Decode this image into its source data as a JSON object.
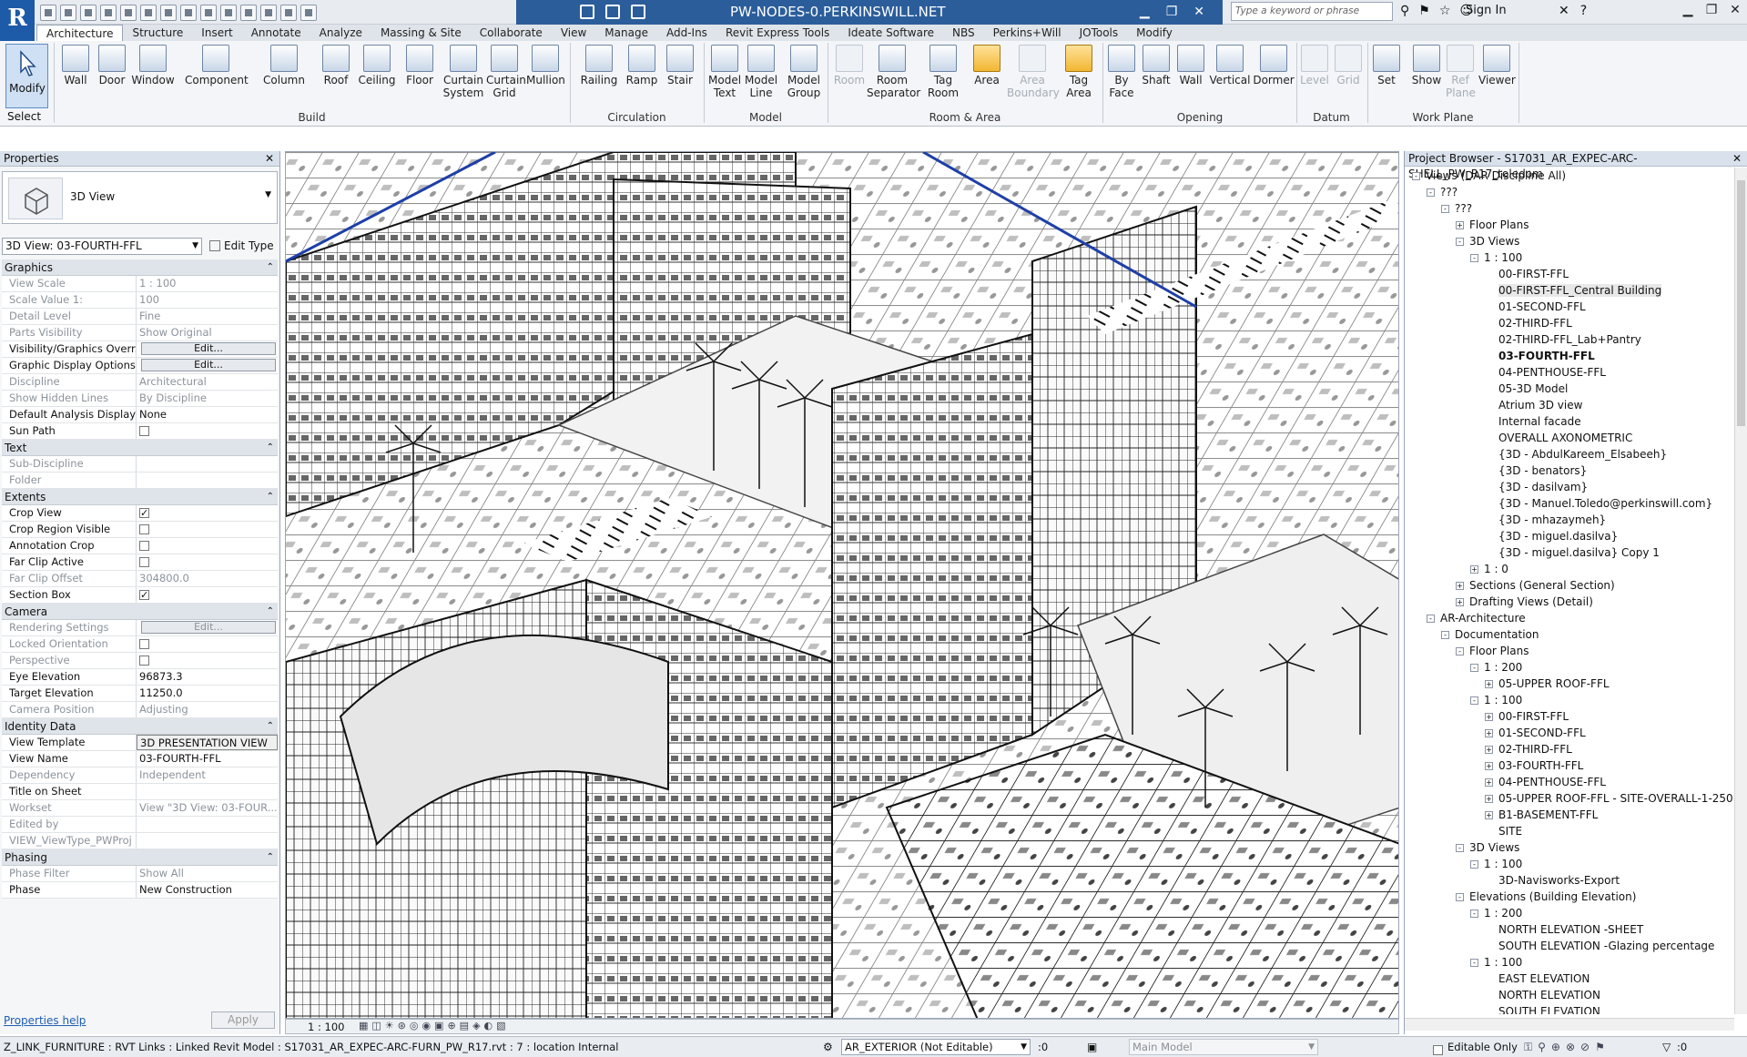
{
  "titlebar": {
    "server_title": "PW-NODES-0.PERKINSWILL.NET",
    "search_placeholder": "Type a keyword or phrase",
    "sign_in": "Sign In"
  },
  "ribbon_tabs": [
    "Architecture",
    "Structure",
    "Insert",
    "Annotate",
    "Analyze",
    "Massing & Site",
    "Collaborate",
    "View",
    "Manage",
    "Add-Ins",
    "Revit Express Tools",
    "Ideate Software",
    "NBS",
    "Perkins+Will",
    "JOTools",
    "Modify"
  ],
  "ribbon": {
    "select_label": "Select",
    "modify": "Modify",
    "build": [
      "Wall",
      "Door",
      "Window",
      "Component",
      "Column",
      "Roof",
      "Ceiling",
      "Floor",
      "Curtain System",
      "Curtain Grid",
      "Mullion"
    ],
    "circulation": [
      "Railing",
      "Ramp",
      "Stair"
    ],
    "model": [
      "Model Text",
      "Model Line",
      "Model Group"
    ],
    "room_area": [
      "Room",
      "Room Separator",
      "Tag Room",
      "Area",
      "Area Boundary",
      "Tag Area"
    ],
    "opening": [
      "By Face",
      "Shaft",
      "Wall",
      "Vertical",
      "Dormer"
    ],
    "datum": [
      "Level",
      "Grid"
    ],
    "workplane": [
      "Set",
      "Show",
      "Ref Plane",
      "Viewer"
    ],
    "panels": [
      "Build",
      "Circulation",
      "Model",
      "Room & Area",
      "Opening",
      "Datum",
      "Work Plane"
    ]
  },
  "properties": {
    "title": "Properties",
    "type_name": "3D View",
    "view_selector": "3D View: 03-FOURTH-FFL",
    "edit_type": "Edit Type",
    "help": "Properties help",
    "apply": "Apply",
    "groups": [
      {
        "name": "Graphics",
        "rows": [
          [
            "View Scale",
            "1 : 100",
            true
          ],
          [
            "Scale Value    1:",
            "100",
            true
          ],
          [
            "Detail Level",
            "Fine",
            true
          ],
          [
            "Parts Visibility",
            "Show Original",
            true
          ],
          [
            "Visibility/Graphics Overr...",
            "Edit...",
            false
          ],
          [
            "Graphic Display Options",
            "Edit...",
            false
          ],
          [
            "Discipline",
            "Architectural",
            true
          ],
          [
            "Show Hidden Lines",
            "By Discipline",
            true
          ],
          [
            "Default Analysis Display ...",
            "None",
            false
          ],
          [
            "Sun Path",
            "",
            false
          ]
        ]
      },
      {
        "name": "Text",
        "rows": [
          [
            "Sub-Discipline",
            "",
            true
          ],
          [
            "Folder",
            "",
            true
          ]
        ]
      },
      {
        "name": "Extents",
        "rows": [
          [
            "Crop View",
            "",
            false
          ],
          [
            "Crop Region Visible",
            "",
            false
          ],
          [
            "Annotation Crop",
            "",
            false
          ],
          [
            "Far Clip Active",
            "",
            false
          ],
          [
            "Far Clip Offset",
            "304800.0",
            true
          ],
          [
            "Section Box",
            "",
            false
          ]
        ]
      },
      {
        "name": "Camera",
        "rows": [
          [
            "Rendering Settings",
            "Edit...",
            true
          ],
          [
            "Locked Orientation",
            "",
            true
          ],
          [
            "Perspective",
            "",
            true
          ],
          [
            "Eye Elevation",
            "96873.3",
            false
          ],
          [
            "Target Elevation",
            "11250.0",
            false
          ],
          [
            "Camera Position",
            "Adjusting",
            true
          ]
        ]
      },
      {
        "name": "Identity Data",
        "rows": [
          [
            "View Template",
            "3D PRESENTATION VIEW",
            false
          ],
          [
            "View Name",
            "03-FOURTH-FFL",
            false
          ],
          [
            "Dependency",
            "Independent",
            true
          ],
          [
            "Title on Sheet",
            "",
            false
          ],
          [
            "Workset",
            "View \"3D View: 03-FOUR...",
            true
          ],
          [
            "Edited by",
            "",
            true
          ],
          [
            "VIEW_ViewType_PWProj",
            "",
            true
          ]
        ]
      },
      {
        "name": "Phasing",
        "rows": [
          [
            "Phase Filter",
            "Show All",
            true
          ],
          [
            "Phase",
            "New Construction",
            false
          ]
        ]
      }
    ]
  },
  "viewport": {
    "scale": "1 : 100"
  },
  "browser": {
    "title": "Project Browser - S17031_AR_EXPEC-ARC-SHELL_PW_R17_toledom",
    "nodes": [
      [
        0,
        "-",
        "Views (DAR Discipline All)"
      ],
      [
        1,
        "-",
        "???"
      ],
      [
        2,
        "-",
        "???"
      ],
      [
        3,
        "+",
        "Floor Plans"
      ],
      [
        3,
        "-",
        "3D Views"
      ],
      [
        4,
        "-",
        "1 : 100"
      ],
      [
        5,
        "",
        "00-FIRST-FFL"
      ],
      [
        5,
        "",
        "00-FIRST-FFL_Central Building"
      ],
      [
        5,
        "",
        "01-SECOND-FFL"
      ],
      [
        5,
        "",
        "02-THIRD-FFL"
      ],
      [
        5,
        "",
        "02-THIRD-FFL_Lab+Pantry"
      ],
      [
        5,
        "",
        "03-FOURTH-FFL"
      ],
      [
        5,
        "",
        "04-PENTHOUSE-FFL"
      ],
      [
        5,
        "",
        "05-3D Model"
      ],
      [
        5,
        "",
        "Atrium 3D view"
      ],
      [
        5,
        "",
        "Internal facade"
      ],
      [
        5,
        "",
        "OVERALL AXONOMETRIC"
      ],
      [
        5,
        "",
        "{3D - AbdulKareem_Elsabeeh}"
      ],
      [
        5,
        "",
        "{3D - benators}"
      ],
      [
        5,
        "",
        "{3D - dasilvam}"
      ],
      [
        5,
        "",
        "{3D - Manuel.Toledo@perkinswill.com}"
      ],
      [
        5,
        "",
        "{3D - mhazaymeh}"
      ],
      [
        5,
        "",
        "{3D - miguel.dasilva}"
      ],
      [
        5,
        "",
        "{3D - miguel.dasilva} Copy 1"
      ],
      [
        4,
        "+",
        "1 : 0"
      ],
      [
        3,
        "+",
        "Sections (General Section)"
      ],
      [
        3,
        "+",
        "Drafting Views (Detail)"
      ],
      [
        1,
        "-",
        "AR-Architecture"
      ],
      [
        2,
        "-",
        "Documentation"
      ],
      [
        3,
        "-",
        "Floor Plans"
      ],
      [
        4,
        "-",
        "1 : 200"
      ],
      [
        5,
        "+",
        "05-UPPER ROOF-FFL"
      ],
      [
        4,
        "-",
        "1 : 100"
      ],
      [
        5,
        "+",
        "00-FIRST-FFL"
      ],
      [
        5,
        "+",
        "01-SECOND-FFL"
      ],
      [
        5,
        "+",
        "02-THIRD-FFL"
      ],
      [
        5,
        "+",
        "03-FOURTH-FFL"
      ],
      [
        5,
        "+",
        "04-PENTHOUSE-FFL"
      ],
      [
        5,
        "+",
        "05-UPPER ROOF-FFL - SITE-OVERALL-1-250"
      ],
      [
        5,
        "+",
        "B1-BASEMENT-FFL"
      ],
      [
        5,
        "",
        "SITE"
      ],
      [
        3,
        "-",
        "3D Views"
      ],
      [
        4,
        "-",
        "1 : 100"
      ],
      [
        5,
        "",
        "3D-Navisworks-Export"
      ],
      [
        3,
        "-",
        "Elevations (Building Elevation)"
      ],
      [
        4,
        "-",
        "1 : 200"
      ],
      [
        5,
        "",
        "NORTH ELEVATION -SHEET"
      ],
      [
        5,
        "",
        "SOUTH ELEVATION -Glazing percentage"
      ],
      [
        4,
        "-",
        "1 : 100"
      ],
      [
        5,
        "",
        "EAST ELEVATION"
      ],
      [
        5,
        "",
        "NORTH ELEVATION"
      ],
      [
        5,
        "",
        "SOUTH ELEVATION"
      ]
    ],
    "highlight": "00-FIRST-FFL_Central Building",
    "bold": "03-FOURTH-FFL"
  },
  "status": {
    "message": "Z_LINK_FURNITURE : RVT Links : Linked Revit Model : S17031_AR_EXPEC-ARC-FURN_PW_R17.rvt : 7 : location Internal",
    "workset": "AR_EXTERIOR (Not Editable)",
    "zero": ":0",
    "main_model": "Main Model",
    "editable_only": "Editable Only",
    "filter": ":0"
  }
}
